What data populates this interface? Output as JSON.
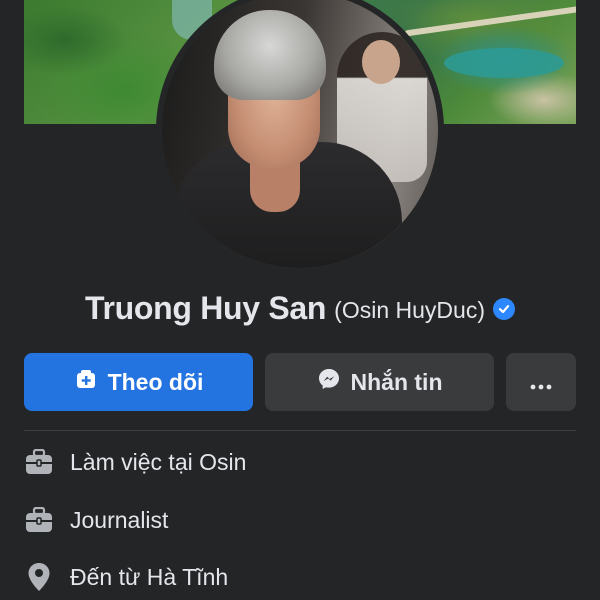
{
  "profile": {
    "name": "Truong Huy San",
    "alternate_name": "(Osin HuyDuc)",
    "verified": true
  },
  "actions": {
    "follow_label": "Theo dõi",
    "message_label": "Nhắn tin",
    "more_label": "···"
  },
  "intro": {
    "items": [
      {
        "icon": "briefcase-icon",
        "text": "Làm việc tại Osin"
      },
      {
        "icon": "briefcase-icon",
        "text": "Journalist"
      },
      {
        "icon": "location-pin-icon",
        "text": "Đến từ Hà Tĩnh"
      }
    ]
  },
  "colors": {
    "background": "#242526",
    "primary_button": "#2374e1",
    "secondary_button": "#3a3b3c",
    "verified_badge": "#2d88ff",
    "text": "#e4e6eb",
    "icon": "#b0b3b8"
  }
}
